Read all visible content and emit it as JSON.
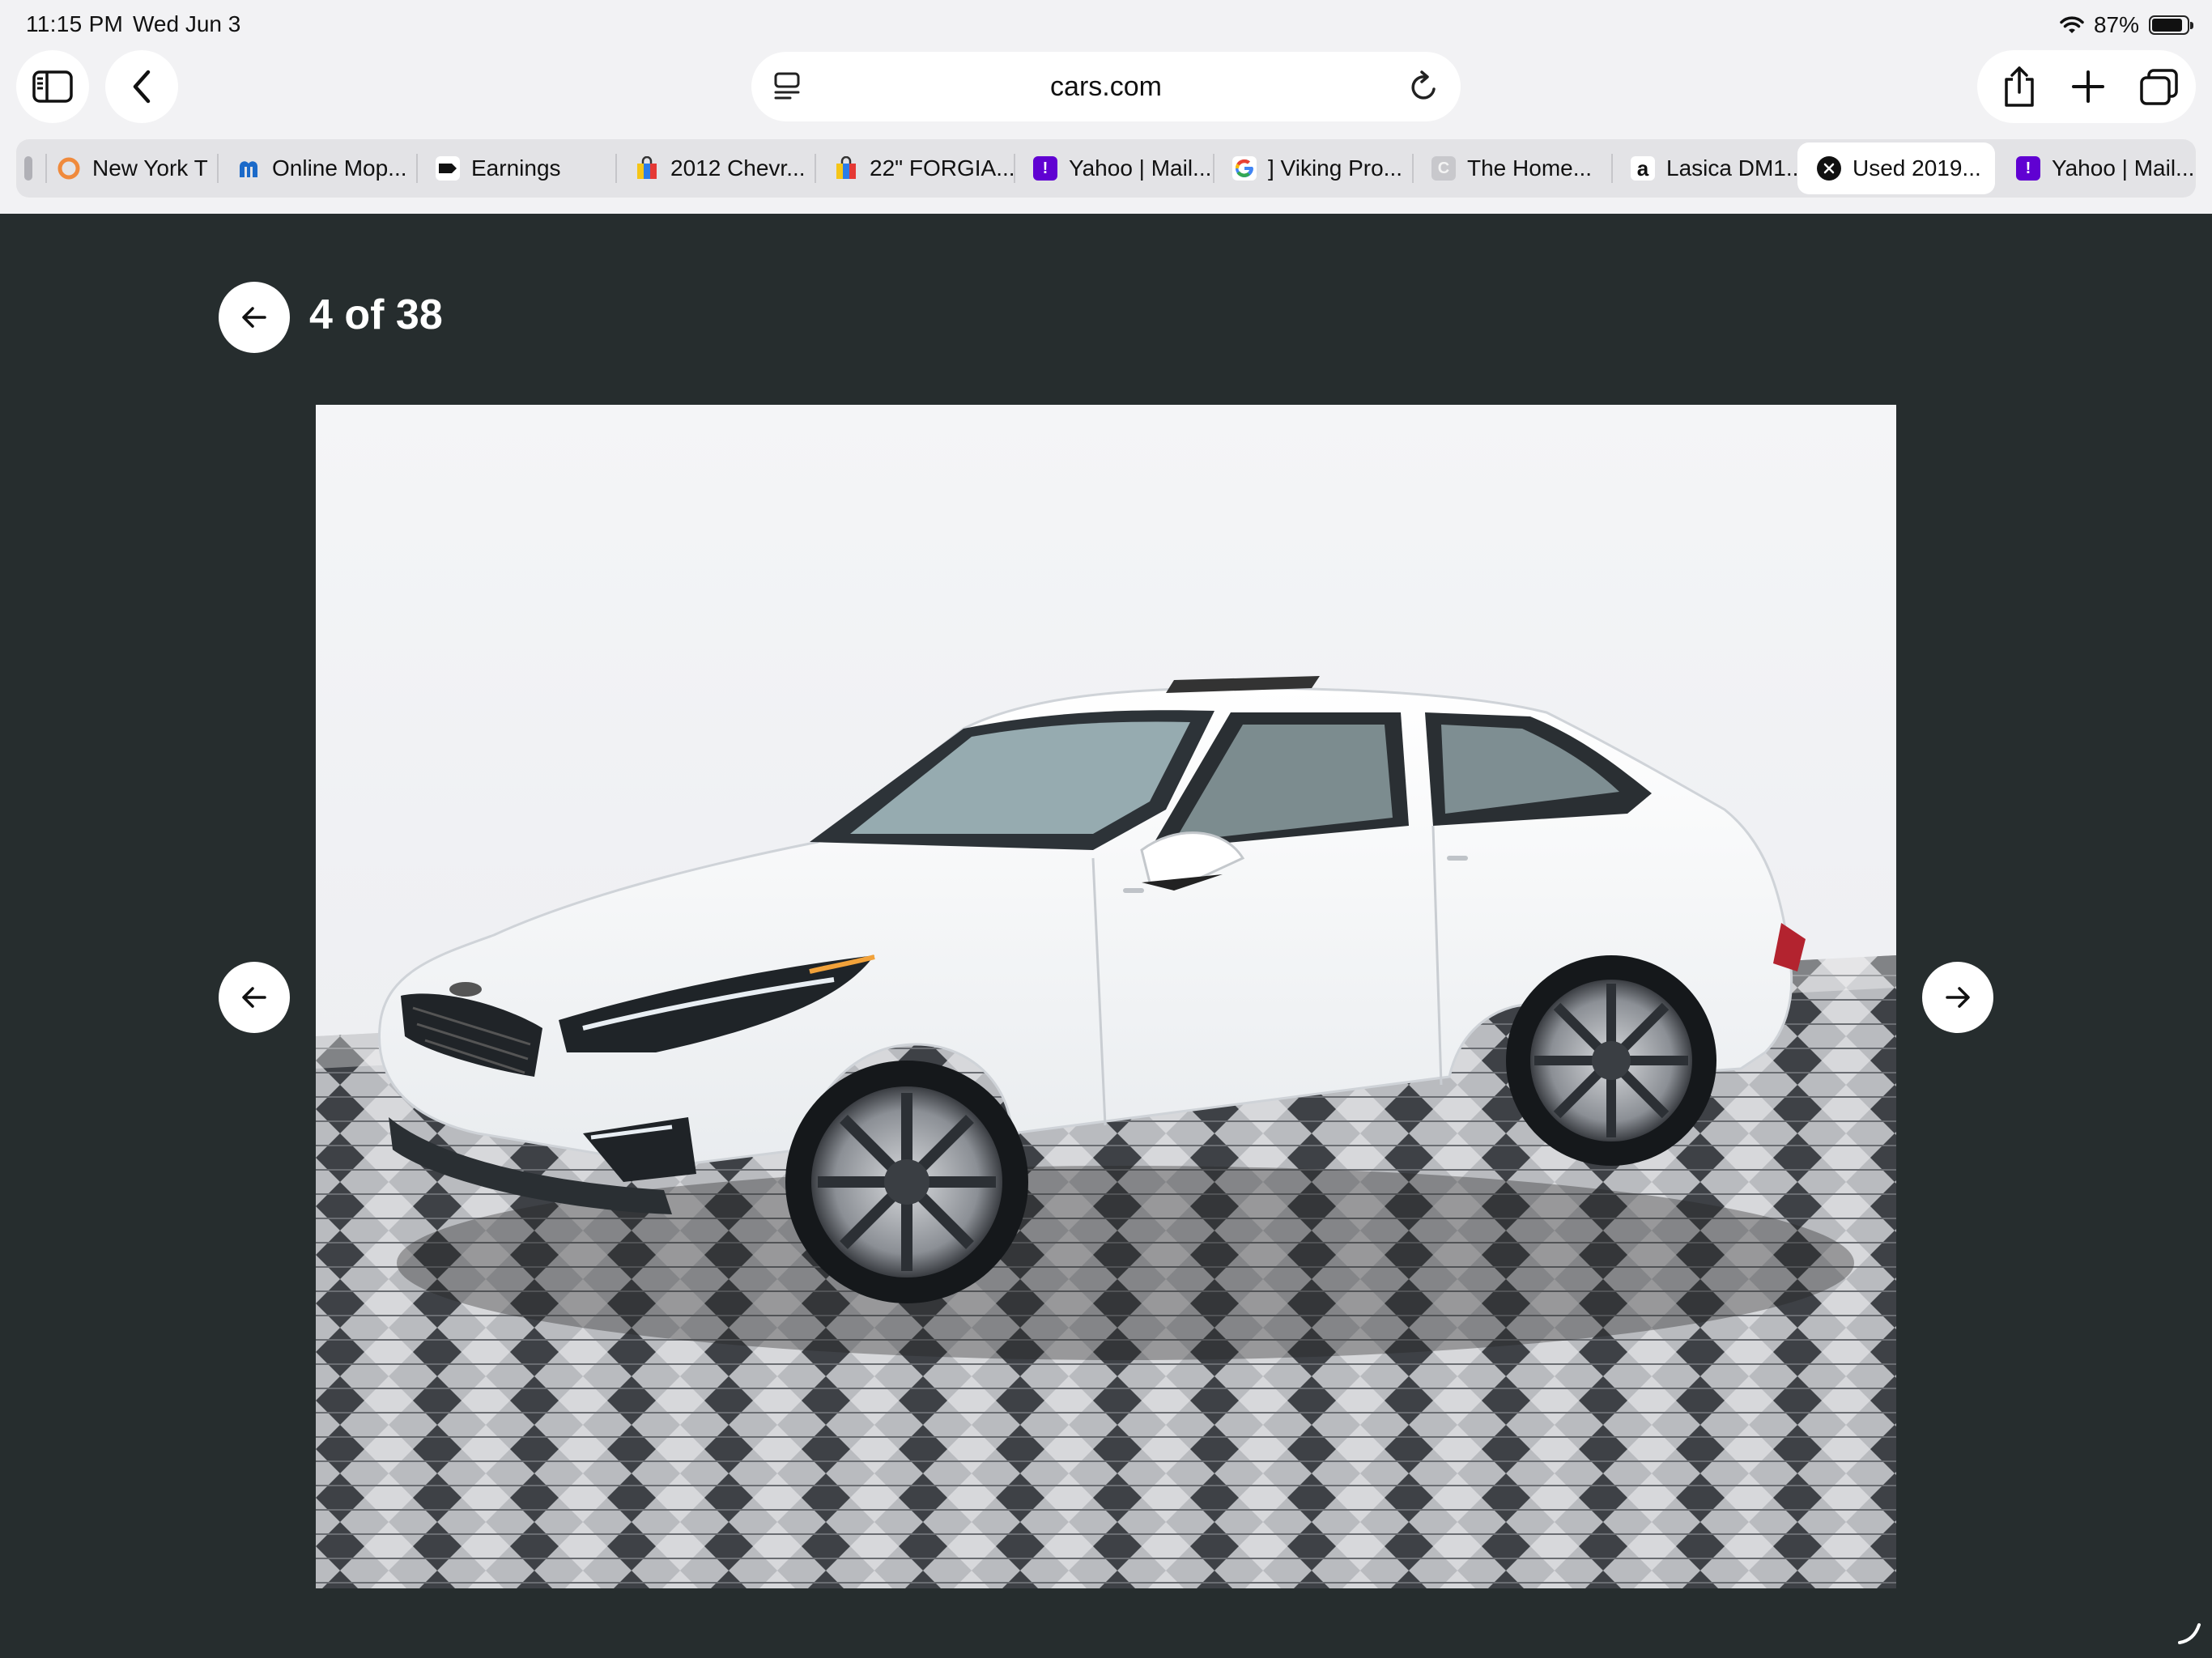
{
  "status_bar": {
    "time": "11:15 PM",
    "date": "Wed Jun 3",
    "battery": "87%",
    "battery_level": 0.87
  },
  "toolbar": {
    "address": "cars.com"
  },
  "tabs": [
    {
      "label": "",
      "favicon": "partial-icon",
      "color": "#9aa0a6"
    },
    {
      "label": "New York T",
      "favicon": "circle-icon",
      "color": "#f08a3c"
    },
    {
      "label": "Online Mop...",
      "favicon": "mopar-icon",
      "color": "#1b6ac9"
    },
    {
      "label": "Earnings",
      "favicon": "tag-icon",
      "color": "#111111"
    },
    {
      "label": "2012 Chevr...",
      "favicon": "bag-icon",
      "color": "#2b7de9"
    },
    {
      "label": "22\" FORGIA...",
      "favicon": "bag-icon",
      "color": "#2b7de9"
    },
    {
      "label": "Yahoo | Mail...",
      "favicon": "yahoo-icon",
      "color": "#6001d2"
    },
    {
      "label": "] Viking Pro...",
      "favicon": "google-icon",
      "color": "#4285f4"
    },
    {
      "label": "The Home...",
      "favicon": "c-icon",
      "color": "#c8c8cc"
    },
    {
      "label": "Lasica DM1...",
      "favicon": "amazon-icon",
      "color": "#111111"
    },
    {
      "label": "Used 2019...",
      "favicon": "close-icon",
      "color": "#111111",
      "active": true
    },
    {
      "label": "Yahoo | Mail...",
      "favicon": "yahoo-icon",
      "color": "#6001d2"
    }
  ],
  "gallery": {
    "counter": "4 of 38",
    "background": "#262d2e"
  }
}
